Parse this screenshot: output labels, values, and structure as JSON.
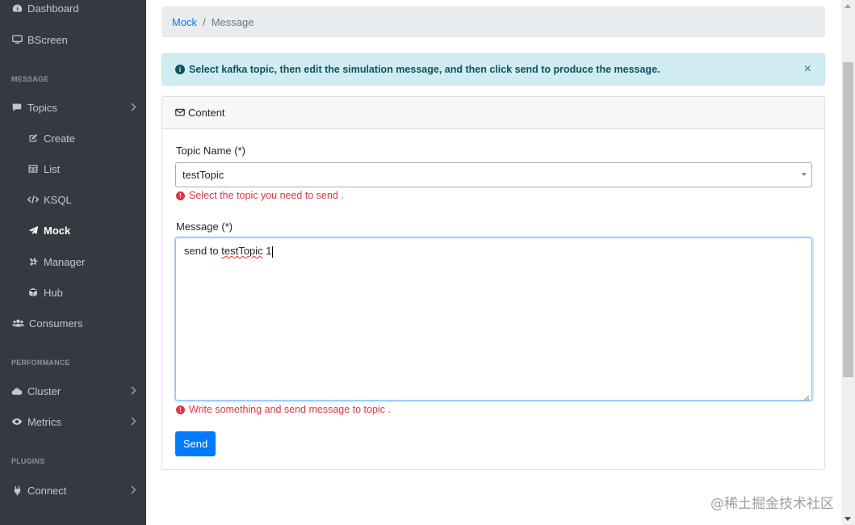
{
  "sidebar": {
    "items_top": [
      {
        "label": "Dashboard",
        "icon": "tachometer-icon"
      },
      {
        "label": "BScreen",
        "icon": "desktop-icon"
      }
    ],
    "sections": [
      {
        "header": "MESSAGE"
      },
      {
        "header": "PERFORMANCE"
      },
      {
        "header": "PLUGINS"
      }
    ],
    "topics": {
      "label": "Topics",
      "icon": "comment-icon"
    },
    "topic_children": [
      {
        "label": "Create",
        "icon": "edit-icon"
      },
      {
        "label": "List",
        "icon": "table-icon"
      },
      {
        "label": "KSQL",
        "icon": "code-icon"
      },
      {
        "label": "Mock",
        "icon": "paper-plane-icon"
      },
      {
        "label": "Manager",
        "icon": "tools-icon"
      },
      {
        "label": "Hub",
        "icon": "cube-icon"
      }
    ],
    "consumers": {
      "label": "Consumers",
      "icon": "users-icon"
    },
    "cluster": {
      "label": "Cluster",
      "icon": "cloud-icon"
    },
    "metrics": {
      "label": "Metrics",
      "icon": "eye-icon"
    },
    "connect": {
      "label": "Connect",
      "icon": "plug-icon"
    }
  },
  "breadcrumb": {
    "link": "Mock",
    "separator": "/",
    "current": "Message"
  },
  "alert": {
    "text": "Select kafka topic, then edit the simulation message, and then click send to produce the message.",
    "close": "×"
  },
  "card": {
    "header": "Content",
    "topic_label": "Topic Name (*)",
    "topic_value": "testTopic",
    "topic_error": "Select the topic you need to send .",
    "message_label": "Message (*)",
    "message_value_prefix": "send to ",
    "message_value_word": "testTopic",
    "message_value_suffix": " 1",
    "message_error": "Write something and send message to topic .",
    "send_label": "Send"
  },
  "watermark": "@稀土掘金技术社区",
  "colors": {
    "sidebar": "#343a40",
    "primary": "#007bff",
    "danger": "#dc3545",
    "info_bg": "#d1ecf1"
  }
}
